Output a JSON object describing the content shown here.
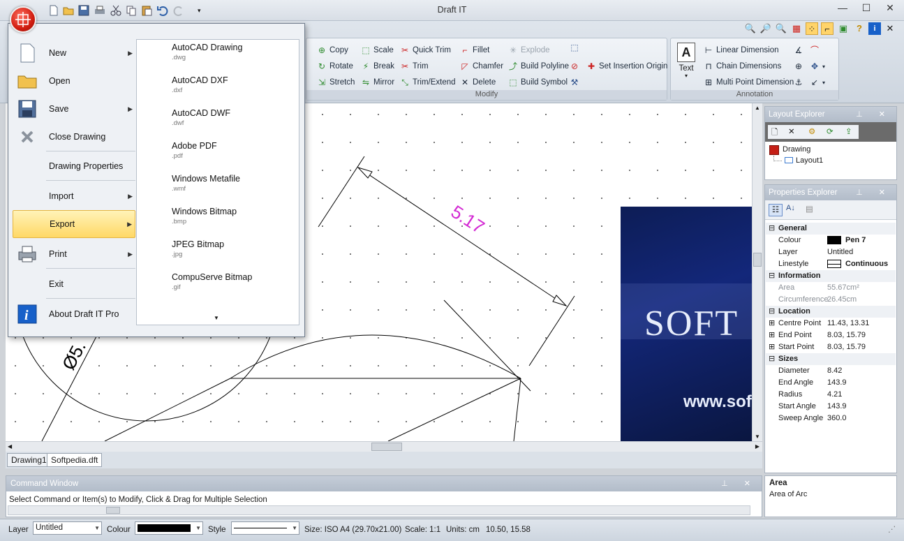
{
  "app": {
    "title": "Draft IT"
  },
  "ribbon": {
    "modify": {
      "label": "Modify",
      "buttons": {
        "copy": "Copy",
        "scale": "Scale",
        "quick_trim": "Quick Trim",
        "fillet": "Fillet",
        "explode": "Explode",
        "rotate": "Rotate",
        "break": "Break",
        "trim": "Trim",
        "chamfer": "Chamfer",
        "build_polyline": "Build Polyline",
        "set_insertion_origin": "Set Insertion Origin",
        "stretch": "Stretch",
        "mirror": "Mirror",
        "trim_extend": "Trim/Extend",
        "delete": "Delete",
        "build_symbol": "Build Symbol"
      }
    },
    "annotation": {
      "label": "Annotation",
      "text": "Text",
      "linear_dimension": "Linear Dimension",
      "chain_dimensions": "Chain Dimensions",
      "multi_point_dimension": "Multi Point Dimension"
    }
  },
  "app_menu": {
    "items": {
      "new": "New",
      "open": "Open",
      "save": "Save",
      "close_drawing": "Close Drawing",
      "drawing_properties": "Drawing Properties",
      "import": "Import",
      "export": "Export",
      "print": "Print",
      "exit": "Exit",
      "about": "About Draft IT Pro"
    },
    "export_options": [
      {
        "title": "AutoCAD Drawing",
        "ext": ".dwg"
      },
      {
        "title": "AutoCAD DXF",
        "ext": ".dxf"
      },
      {
        "title": "AutoCAD DWF",
        "ext": ".dwf"
      },
      {
        "title": "Adobe PDF",
        "ext": ".pdf"
      },
      {
        "title": "Windows Metafile",
        "ext": ".wmf"
      },
      {
        "title": "Windows Bitmap",
        "ext": ".bmp"
      },
      {
        "title": "JPEG Bitmap",
        "ext": ".jpg"
      },
      {
        "title": "CompuServe Bitmap",
        "ext": ".gif"
      }
    ]
  },
  "drawing": {
    "dimension_text": "5.17",
    "diameter_text": "Ø5.",
    "image_text_1": "SOFT",
    "image_text_2": "www.sof"
  },
  "doc_tabs": [
    "Drawing1",
    "Softpedia.dft"
  ],
  "command_window": {
    "title": "Command Window",
    "message": "Select Command or Item(s) to Modify, Click & Drag for Multiple Selection"
  },
  "layout_explorer": {
    "title": "Layout Explorer",
    "root": "Drawing",
    "child": "Layout1"
  },
  "properties_explorer": {
    "title": "Properties Explorer",
    "categories": {
      "general": "General",
      "information": "Information",
      "location": "Location",
      "sizes": "Sizes"
    },
    "rows": {
      "colour": {
        "name": "Colour",
        "value": "Pen 7",
        "color": "#000000"
      },
      "layer": {
        "name": "Layer",
        "value": "Untitled"
      },
      "linestyle": {
        "name": "Linestyle",
        "value": "Continuous"
      },
      "area": {
        "name": "Area",
        "value": "55.67cm²"
      },
      "circumference": {
        "name": "Circumference",
        "value": "26.45cm"
      },
      "centre_point": {
        "name": "Centre Point",
        "value": "11.43, 13.31"
      },
      "end_point": {
        "name": "End Point",
        "value": "8.03, 15.79"
      },
      "start_point": {
        "name": "Start Point",
        "value": "8.03, 15.79"
      },
      "diameter": {
        "name": "Diameter",
        "value": "8.42"
      },
      "end_angle": {
        "name": "End Angle",
        "value": "143.9"
      },
      "radius": {
        "name": "Radius",
        "value": "4.21"
      },
      "start_angle": {
        "name": "Start Angle",
        "value": "143.9"
      },
      "sweep_angle": {
        "name": "Sweep Angle",
        "value": "360.0"
      }
    },
    "description_title": "Area",
    "description_text": "Area of Arc"
  },
  "status_bar": {
    "layer_label": "Layer",
    "layer_value": "Untitled",
    "colour_label": "Colour",
    "colour_value": "#000000",
    "style_label": "Style",
    "size": "Size: ISO A4 (29.70x21.00)",
    "scale": "Scale: 1:1",
    "units": "Units: cm",
    "coords": "10.50, 15.58"
  }
}
